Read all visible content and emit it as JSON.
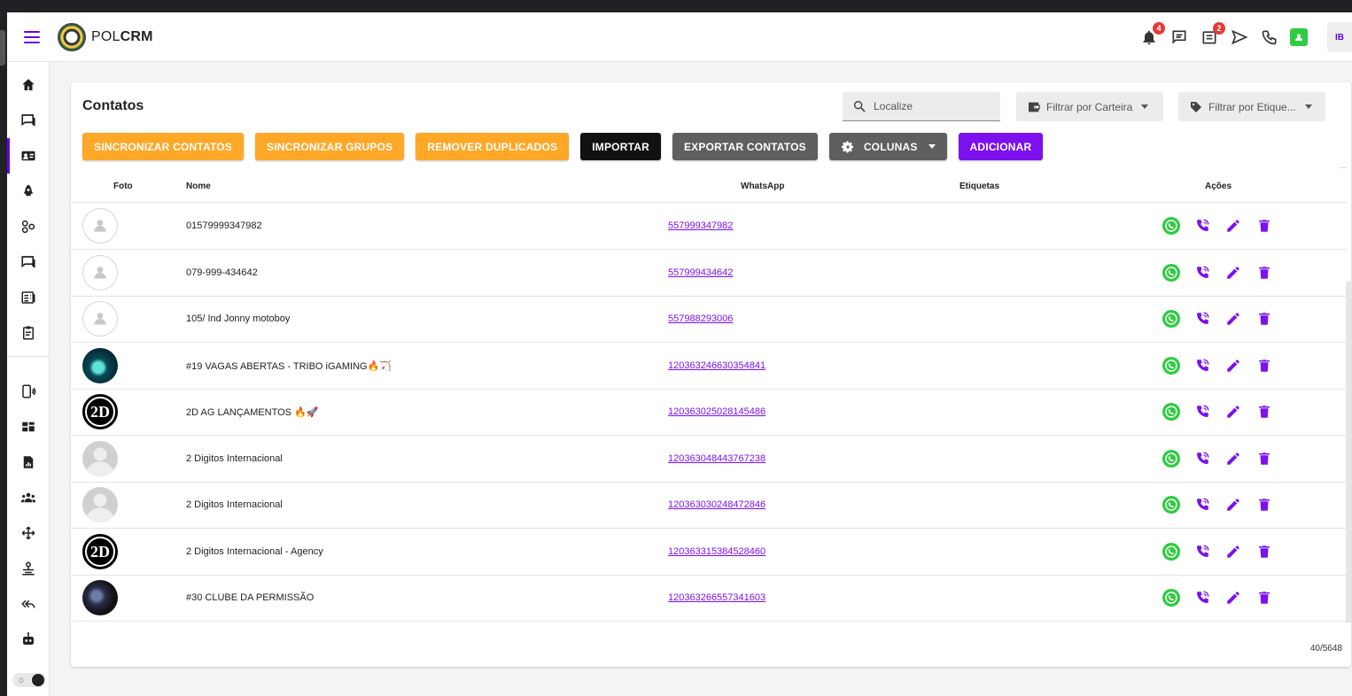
{
  "app": {
    "brand_prefix": "POL",
    "brand_suffix": "CRM",
    "avatar_initials": "IB",
    "notifications_count": "4",
    "tasks_count": "2",
    "accent_color": "#7c10ef",
    "warn_color": "#ffa726"
  },
  "sidebar": {
    "items": [
      {
        "icon": "home-icon",
        "active": false
      },
      {
        "icon": "chat-icon",
        "active": false
      },
      {
        "icon": "contacts-icon",
        "active": true
      },
      {
        "icon": "rocket-icon",
        "active": false
      },
      {
        "icon": "connections-icon",
        "active": false
      },
      {
        "icon": "chat-list-icon",
        "active": false
      },
      {
        "icon": "kanban-icon",
        "active": false
      },
      {
        "icon": "clipboard-icon",
        "active": false
      },
      {
        "icon": "device-icon",
        "active": false
      },
      {
        "icon": "dashboard-icon",
        "active": false
      },
      {
        "icon": "report-icon",
        "active": false
      },
      {
        "icon": "users-icon",
        "active": false
      },
      {
        "icon": "move-icon",
        "active": false
      },
      {
        "icon": "queue-icon",
        "active": false
      },
      {
        "icon": "reply-all-icon",
        "active": false
      },
      {
        "icon": "bot-icon",
        "active": false
      }
    ]
  },
  "page": {
    "title": "Contatos",
    "search_placeholder": "Localize",
    "filter_wallet": "Filtrar por Carteira",
    "filter_tags": "Filtrar por Etique..."
  },
  "toolbar": {
    "sync_contacts": "SINCRONIZAR CONTATOS",
    "sync_groups": "SINCRONIZAR GRUPOS",
    "remove_duplicates": "REMOVER DUPLICADOS",
    "import": "IMPORTAR",
    "export": "EXPORTAR CONTATOS",
    "columns": "COLUNAS",
    "add": "ADICIONAR"
  },
  "table": {
    "headers": {
      "photo": "Foto",
      "name": "Nome",
      "whatsapp": "WhatsApp",
      "tags": "Etiquetas",
      "actions": "Ações"
    },
    "rows": [
      {
        "photo": "default",
        "name": "01579999347982",
        "whatsapp": "557999347982"
      },
      {
        "photo": "default",
        "name": "079-999-434642",
        "whatsapp": "557999434642"
      },
      {
        "photo": "default",
        "name": "105/ Ind Jonny motoboy",
        "whatsapp": "557988293006"
      },
      {
        "photo": "teal",
        "name": "#19 VAGAS ABERTAS - TRIBO iGAMING🔥🏹",
        "whatsapp": "120363246630354841"
      },
      {
        "photo": "2d",
        "name": "2D AG LANÇAMENTOS 🔥🚀",
        "whatsapp": "120363025028145486"
      },
      {
        "photo": "gray",
        "name": "2 Digitos Internacional",
        "whatsapp": "120363048443767238"
      },
      {
        "photo": "gray",
        "name": "2 Digitos Internacional",
        "whatsapp": "120363030248472846"
      },
      {
        "photo": "2d",
        "name": "2 Digitos Internacional - Agency",
        "whatsapp": "120363315384528460"
      },
      {
        "photo": "club",
        "name": "#30 CLUBE DA PERMISSÃO",
        "whatsapp": "120363266557341603"
      }
    ],
    "count": "40/5648"
  }
}
